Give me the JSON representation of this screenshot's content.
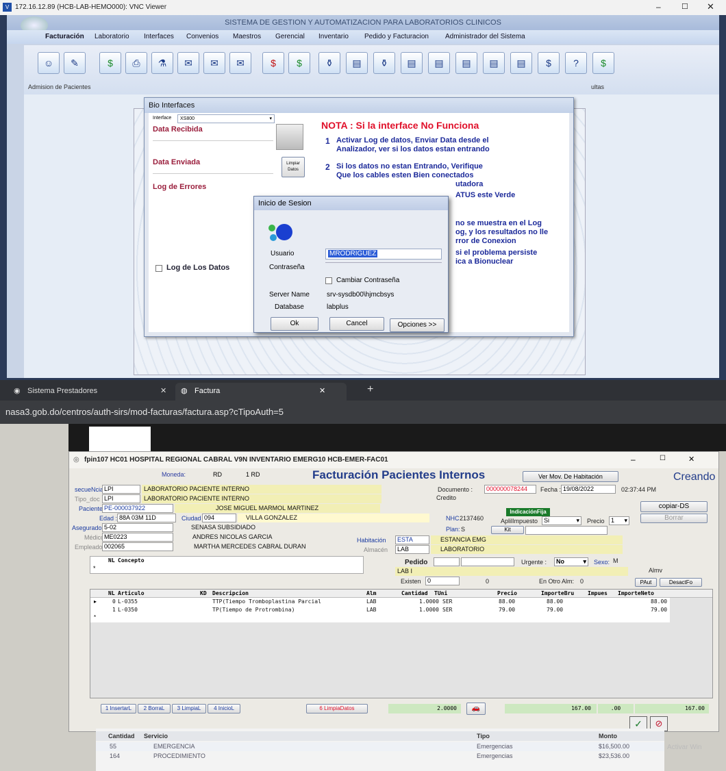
{
  "vnc": {
    "title": "172.16.12.89 (HCB-LAB-HEMO000): VNC Viewer"
  },
  "app": {
    "title": "SISTEMA DE GESTION Y AUTOMATIZACION PARA LABORATORIOS CLINICOS",
    "menu": [
      "Facturación",
      "Laboratorio",
      "Interfaces",
      "Convenios",
      "Maestros",
      "Gerencial",
      "Inventario",
      "Pedido y Facturacion",
      "Administrador del Sistema"
    ],
    "workspace_left_label": "Admision de Pacientes",
    "workspace_right_label": "ultas"
  },
  "bio": {
    "title": "Bio Interfaces",
    "interface_label": "Interface",
    "interface_value": "XS800",
    "data_recibida": "Data Recibida",
    "data_enviada": "Data Enviada",
    "log_errores": "Log de Errores",
    "limpiar_datos": "Limpiar Datos",
    "log_datos": "Log de Los Datos",
    "nota_title": "NOTA : Si la interface No Funciona",
    "nota1_num": "1",
    "nota1": "Activar Log de datos, Enviar Data desde el Analizador, ver si los datos estan entrando",
    "nota2_num": "2",
    "nota2_a": "Si los datos no estan Entrando, Verifique",
    "nota2_b": "Que los cables esten Bien conectados",
    "frag1": "utadora",
    "frag2": "ATUS este Verde",
    "frag3": "no se muestra en el Log",
    "frag4": "og, y los resultados no lle",
    "frag5": "rror de Conexion",
    "frag6": "si el problema persiste",
    "frag7": "ica a Bionuclear"
  },
  "login": {
    "title": "Inicio de Sesion",
    "usuario_label": "Usuario",
    "usuario_value": "MRODRIGUEZ",
    "password_label": "Contraseña",
    "cambiar": "Cambiar Contraseña",
    "server_label": "Server Name",
    "server_value": "srv-sysdb00\\hjmcbsys",
    "db_label": "Database",
    "db_value": "labplus",
    "ok": "Ok",
    "cancel": "Cancel",
    "opciones": "Opciones >>"
  },
  "browser": {
    "tab1": "Sistema Prestadores",
    "tab2": "Factura",
    "url": "nasa3.gob.do/centros/auth-sirs/mod-facturas/factura.asp?cTipoAuth=5"
  },
  "factura": {
    "window_title": "fpin107 HC01 HOSPITAL REGIONAL CABRAL V9N INVENTARIO EMERG10 HCB-EMER-FAC01",
    "heading": "Facturación Pacientes Internos",
    "status": "Creando",
    "moneda_label": "Moneda:",
    "moneda": "RD",
    "moneda2": "1 RD",
    "ver_mov": "Ver Mov. De Habitación",
    "documento_label": "Documento :",
    "documento": "000000078244",
    "fecha_label": "Fecha :",
    "fecha": "19/08/2022",
    "hora": "02:37:44 PM",
    "credito": "Credito",
    "copiar": "copiar-DS",
    "borrar": "Borrar",
    "secuencia_label": "secueNcia",
    "secuencia": "LPI",
    "secuencia_desc": "LABORATORIO PACIENTE INTERNO",
    "tipo_doc_label": "Tipo_doc",
    "tipo_doc": "LPI",
    "tipo_doc_desc": "LABORATORIO PACIENTE INTERNO",
    "paciente_label": "Paciente",
    "paciente_id": "PE-000037922",
    "paciente_nombre": "JOSE MIGUEL MARMOL MARTINEZ",
    "edad_label": "Edad :",
    "edad": "88A 03M 11D",
    "ciudad_label": "Ciudad :",
    "ciudad": "094",
    "ciudad_nombre": "VILLA GONZALEZ",
    "nhc_label": "NHC",
    "nhc": "2137460",
    "indicacion": "IndicaciónFija",
    "apli_label": "AplilImpuesto",
    "apli": "Si",
    "precio_label": "Precio",
    "precio": "1",
    "aseg_label": "Aseguradora",
    "aseg": "5-02",
    "aseg_nombre": "SENASA SUBSIDIADO",
    "plan_label": "Plan:",
    "plan": "S",
    "kit_label": "Kit",
    "medico_label": "Médico",
    "medico": "ME0223",
    "medico_nombre": "ANDRES NICOLAS GARCIA",
    "habitacion_label": "Habitación",
    "habitacion": "ESTA",
    "habitacion_nombre": "ESTANCIA EMG",
    "empleado_label": "Empleado",
    "empleado": "002065",
    "empleado_nombre": "MARTHA MERCEDES CABRAL DURAN",
    "almacen_label": "Almacén",
    "almacen": "LAB",
    "almacen_nombre": "LABORATORIO",
    "concepto_nl": "NL",
    "concepto": "Concepto",
    "pedido_label": "Pedido",
    "urgente_label": "Urgente :",
    "urgente": "No",
    "sexo_label": "Sexo:",
    "sexo": "M",
    "lab_i": "LAB I",
    "almv": "Almv",
    "existen_label": "Existen",
    "existen": "0",
    "existen2": "0",
    "otro_alm_label": "En Otro Alm:",
    "otro_alm": "0",
    "paut": "PAut",
    "desact": "DesactFo",
    "columns": [
      "NL",
      "Articulo",
      "KD",
      "Descripcion",
      "Alm",
      "Cantidad",
      "TUni",
      "Precio",
      "ImporteBru",
      "Impues",
      "ImporteNeto"
    ],
    "rows": [
      {
        "nl": "0",
        "articulo": "L-0355",
        "kd": "",
        "desc": "TTP(Tiempo Tromboplastina Parcial",
        "alm": "LAB",
        "cant": "1.0000",
        "tuni": "SER",
        "precio": "88.00",
        "bru": "88.00",
        "imp": "",
        "neto": "88.00"
      },
      {
        "nl": "1",
        "articulo": "L-0350",
        "kd": "",
        "desc": "TP(Tiempo de Protrombina)",
        "alm": "LAB",
        "cant": "1.0000",
        "tuni": "SER",
        "precio": "79.00",
        "bru": "79.00",
        "imp": "",
        "neto": "79.00"
      }
    ],
    "btn_insertar": "1 InsertarL",
    "btn_borrar": "2 BorraL",
    "btn_limpia": "3 LimpiaL",
    "btn_inicio": "4 InicioL",
    "btn_limpia_datos": "6 LimpiaDatos",
    "total_cant": "2.0000",
    "total_bru": "167.00",
    "total_imp": ".00",
    "total_neto": "167.00"
  },
  "servicios": {
    "headers": [
      "Cantidad",
      "Servicio",
      "Tipo",
      "Monto"
    ],
    "rows": [
      {
        "cant": "55",
        "servicio": "EMERGENCIA",
        "tipo": "Emergencias",
        "monto": "$16,500.00"
      },
      {
        "cant": "164",
        "servicio": "PROCEDIMIENTO",
        "tipo": "Emergencias",
        "monto": "$23,536.00"
      }
    ],
    "watermark": "Activar Win"
  }
}
